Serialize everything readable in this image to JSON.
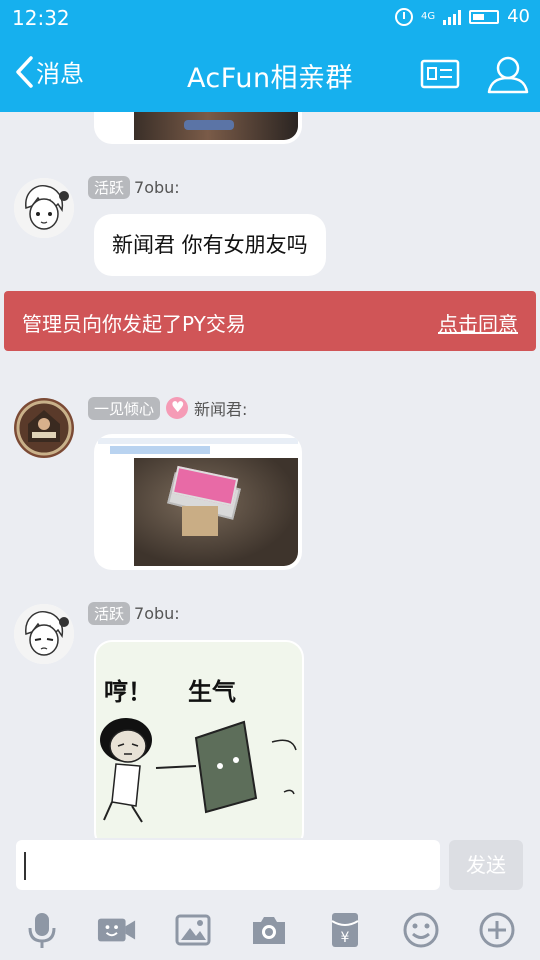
{
  "status_bar": {
    "time": "12:32",
    "network": "4G",
    "battery": "40"
  },
  "nav": {
    "back_label": "消息",
    "title": "AcFun相亲群"
  },
  "messages": [
    {
      "badge": "活跃",
      "sender": "7obu:",
      "text": "新闻君 你有女朋友吗"
    },
    {
      "badge": "一见倾心",
      "sender": "新闻君:"
    },
    {
      "badge": "活跃",
      "sender": "7obu:",
      "sticker_text_1": "哼！",
      "sticker_text_2": "生气"
    }
  ],
  "alert": {
    "message": "管理员向你发起了PY交易",
    "action": "点击同意"
  },
  "input": {
    "value": "",
    "send_label": "发送"
  },
  "colors": {
    "accent": "#16b0ee",
    "alert": "#d05557",
    "background": "#ebedf2"
  },
  "toolbar_icons": [
    "microphone-icon",
    "video-icon",
    "image-icon",
    "camera-icon",
    "red-packet-icon",
    "emoji-icon",
    "plus-icon"
  ]
}
